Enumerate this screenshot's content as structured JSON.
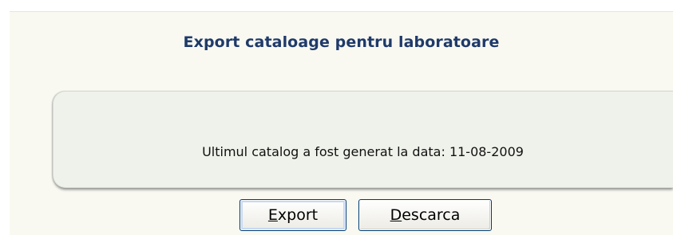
{
  "header": {
    "title": "Export cataloage pentru laboratoare"
  },
  "info": {
    "message": "Ultimul catalog a fost generat la data: 11-08-2009"
  },
  "buttons": {
    "export": {
      "accesskey": "E",
      "rest": "xport"
    },
    "descarca": {
      "accesskey": "D",
      "rest": "escarca"
    }
  },
  "colors": {
    "title": "#1f3a6a",
    "panel_bg": "#f9f9f2",
    "info_box_bg": "#eff2ea",
    "button_border": "#003c74"
  }
}
